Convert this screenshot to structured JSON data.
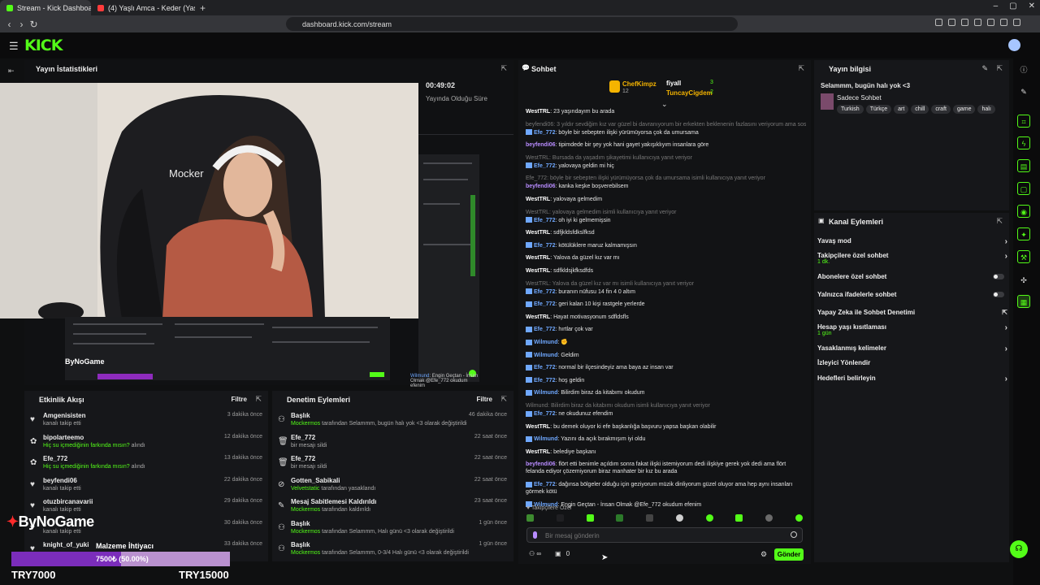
{
  "browser": {
    "tabs": [
      {
        "label": "Stream - Kick Dashboard",
        "fav_color": "#53fc18"
      },
      {
        "label": "(4) Yaşlı Amca - Keder (Yaşlı Amca) -",
        "fav_color": "#ff3b3b"
      }
    ],
    "url": "dashboard.kick.com/stream"
  },
  "brand": {
    "logo": "KICK",
    "accent": "#53fc18"
  },
  "stats": {
    "title": "Yayın İstatistikleri",
    "duration": "00:49:02",
    "duration_label": "Yayında Olduğu Süre"
  },
  "cam": {
    "chair_text": "Mocker"
  },
  "goal": {
    "title": "Malzeme İhtiyacı",
    "progress_text": "7500₺ (50.00%)",
    "progress": 0.5,
    "left": "TRY7000",
    "right": "TRY15000",
    "watermark": "ByNoGame",
    "small_watermark": "ByNoGame"
  },
  "feed": {
    "title": "Etkinlik Akışı",
    "filter": "Filtre",
    "items": [
      {
        "name": "Amgenisisten",
        "sub": "kanalı takip etti",
        "time": "3 dakika önce",
        "icon": "heart-icon"
      },
      {
        "name": "bipolarteemo",
        "sub_hl": "Hiç su içmediğinin farkında mısın?",
        "sub": "alındı",
        "time": "12 dakika önce",
        "icon": "gift-icon"
      },
      {
        "name": "Efe_772",
        "sub_hl": "Hiç su içmediğinin farkında mısın?",
        "sub": "alındı",
        "time": "13 dakika önce",
        "icon": "gift-icon"
      },
      {
        "name": "beyfendi06",
        "sub": "kanalı takip etti",
        "time": "22 dakika önce",
        "icon": "heart-icon"
      },
      {
        "name": "otuzbircanavarii",
        "sub": "kanalı takip etti",
        "time": "29 dakika önce",
        "icon": "heart-icon"
      },
      {
        "name": "",
        "sub": "kanalı takip etti",
        "time": "30 dakika önce",
        "icon": "heart-icon"
      },
      {
        "name": "knight_of_yuki",
        "sub": "",
        "time": "33 dakika önce",
        "icon": "heart-icon"
      }
    ]
  },
  "mod": {
    "title": "Denetim Eylemleri",
    "filter": "Filtre",
    "items": [
      {
        "name": "Başlık",
        "actor": "Mockermos",
        "sub": "tarafından Selammm, bugün halı yok <3 olarak değiştirildi",
        "time": "46 dakika önce",
        "icon": "people-icon"
      },
      {
        "name": "Efe_772",
        "actor": "",
        "sub": "bir mesajı sildi",
        "time": "22 saat önce",
        "icon": "trash-icon"
      },
      {
        "name": "Efe_772",
        "actor": "",
        "sub": "bir mesajı sildi",
        "time": "22 saat önce",
        "icon": "trash-icon"
      },
      {
        "name": "Gotten_Sabikali",
        "actor": "Velvetstatic",
        "sub": "tarafından yasaklandı",
        "time": "22 saat önce",
        "icon": "ban-icon"
      },
      {
        "name": "Mesaj Sabitlemesi Kaldırıldı",
        "actor": "Mockermos",
        "sub": "tarafından kaldırıldı",
        "time": "23 saat önce",
        "icon": "pin-icon"
      },
      {
        "name": "Başlık",
        "actor": "Mockermos",
        "sub": "tarafından Selammm, Halı günü <3 olarak değiştirildi",
        "time": "1 gün önce",
        "icon": "people-icon"
      },
      {
        "name": "Başlık",
        "actor": "Mockermos",
        "sub": "tarafından Selammm, 0-3/4 Halı günü <3 olarak değiştirildi",
        "time": "1 gün önce",
        "icon": "people-icon"
      }
    ]
  },
  "chat": {
    "title": "Sohbet",
    "leaders": [
      {
        "name": "ChefKimpz",
        "count": "12"
      },
      {
        "name": "fiyall",
        "count": "3"
      },
      {
        "name": "TuncayCigdem",
        "count": "2"
      }
    ],
    "messages": [
      {
        "user": "WestTRL",
        "cls": "cw",
        "text": "23 yaşındayım bu arada",
        "reply": ""
      },
      {
        "user": "Efe_772",
        "cls": "ce",
        "text": "böyle bir sebepten ilişki yürümüyorsa çok da umursama",
        "reply": "beyfendi06: 3 yıldır sevdiğim kız var güzel bi davranıyorum bir erkekten beklenenin fazlasını veriyorum ama sosyal..."
      },
      {
        "user": "beyfendi06",
        "cls": "cb",
        "text": "tipimdede bir şey yok hani gayet yakışıklıyım insanlara göre",
        "reply": ""
      },
      {
        "user": "Efe_772",
        "cls": "ce",
        "text": "yalovaya geldin mi hiç",
        "reply": "WestTRL: Bursada da yaşadım şikayetimi kullanıcıya yanıt veriyor"
      },
      {
        "user": "beyfendi06",
        "cls": "cb",
        "text": "kanka keşke boşverebilsem",
        "reply": "Efe_772: böyle bir sebepten ilişki yürümüyorsa çok da umursama isimli kullanıcıya yanıt veriyor"
      },
      {
        "user": "WestTRL",
        "cls": "cw",
        "text": "yalovaya gelmedim",
        "reply": ""
      },
      {
        "user": "Efe_772",
        "cls": "ce",
        "text": "oh iyi ki gelmemişsin",
        "reply": "WestTRL: yalovaya gelmedim isimli kullanıcıya yanıt veriyor"
      },
      {
        "user": "WestTRL",
        "cls": "cw",
        "text": "sdfjkldsfdkslfksd",
        "reply": ""
      },
      {
        "user": "Efe_772",
        "cls": "ce",
        "text": "kötülüklere maruz kalmamışsın",
        "reply": ""
      },
      {
        "user": "WestTRL",
        "cls": "cw",
        "text": "Yalova da güzel kız var mı",
        "reply": ""
      },
      {
        "user": "WestTRL",
        "cls": "cw",
        "text": "sdfkldsjkfksdfds",
        "reply": ""
      },
      {
        "user": "Efe_772",
        "cls": "ce",
        "text": "buranın nüfusu 14 fin 4 0 altım",
        "reply": "WestTRL: Yalova da güzel kız var mı isimli kullanıcıya yanıt veriyor"
      },
      {
        "user": "Efe_772",
        "cls": "ce",
        "text": "geri kalan 10 kişi rastgele yerlerde",
        "reply": ""
      },
      {
        "user": "WestTRL",
        "cls": "cw",
        "text": "Hayat motivasyonum sdfldsfls",
        "reply": ""
      },
      {
        "user": "Efe_772",
        "cls": "ce",
        "text": "hırtlar çok var",
        "reply": ""
      },
      {
        "user": "Wilmund",
        "cls": "cwi",
        "text": "✊",
        "reply": ""
      },
      {
        "user": "Wilmund",
        "cls": "cwi",
        "text": "Geldim",
        "reply": ""
      },
      {
        "user": "Efe_772",
        "cls": "ce",
        "text": "normal bir ilçesindeyiz ama baya az insan var",
        "reply": ""
      },
      {
        "user": "Efe_772",
        "cls": "ce",
        "text": "hoş geldin",
        "reply": ""
      },
      {
        "user": "Wilmund",
        "cls": "cwi",
        "text": "Bilirdim biraz da kitabımı okudum",
        "reply": ""
      },
      {
        "user": "Efe_772",
        "cls": "ce",
        "text": "ne okudunuz efendim",
        "reply": "Wilmund: Bilirdim biraz da kitabımı okudum isimli kullanıcıya yanıt veriyor"
      },
      {
        "user": "WestTRL",
        "cls": "cw",
        "text": "bu demek oluyor ki efe başkanlığa başvuru yapsa başkan olabilir",
        "reply": ""
      },
      {
        "user": "Wilmund",
        "cls": "cwi",
        "text": "Yazını da açık bırakmışım iyi oldu",
        "reply": ""
      },
      {
        "user": "WestTRL",
        "cls": "cw",
        "text": "belediye başkanı",
        "reply": ""
      },
      {
        "user": "beyfendi06",
        "cls": "cb",
        "text": "flört etti benimle açıldım sonra fakat ilişki istemiyorum dedi ilişkiye gerek yok dedi ama flört felanda ediyor çözemiyorum biraz manhater bir kız bu arada",
        "reply": ""
      },
      {
        "user": "Efe_772",
        "cls": "ce",
        "text": "dağınsa bölgeler olduğu için geziyorum müzik dinliyorum güzel oluyor ama hep aynı insanları görmek kötü",
        "reply": ""
      },
      {
        "user": "Wilmund",
        "cls": "cwi",
        "text": "Engin Geçtan - İnsan Olmak @Efe_772 okudum efenim",
        "reply": ""
      }
    ],
    "followers_only": "Takipçilere Özel",
    "input_placeholder": "Bir mesaj gönderin",
    "send_label": "Gönder",
    "points": "0",
    "overlay_msg_user": "Wilmund",
    "overlay_msg_text": "Engin Geçtan - İnsan Olmak @Efe_772 okudum efenim"
  },
  "info": {
    "title": "Yayın bilgisi",
    "stream_title": "Selammm, bugün halı yok <3",
    "category": "Sadece Sohbet",
    "tags": [
      "Turkish",
      "Türkçe",
      "art",
      "chill",
      "craft",
      "game",
      "halı"
    ]
  },
  "actions": {
    "title": "Kanal Eylemleri",
    "items": [
      {
        "label": "Yavaş mod",
        "sub": "",
        "ctl": "chev"
      },
      {
        "label": "Takipçilere özel sohbet",
        "sub": "1 dk.",
        "ctl": "chev"
      },
      {
        "label": "Abonelere özel sohbet",
        "sub": "",
        "ctl": "toggle"
      },
      {
        "label": "Yalnızca ifadelerle sohbet",
        "sub": "",
        "ctl": "toggle"
      },
      {
        "label": "Yapay Zeka ile Sohbet Denetimi",
        "sub": "",
        "ctl": "ext"
      },
      {
        "label": "Hesap yaşı kısıtlaması",
        "sub": "1 gün",
        "ctl": "chev"
      },
      {
        "label": "Yasaklanmış kelimeler",
        "sub": "",
        "ctl": "chev"
      },
      {
        "label": "İzleyici Yönlendir",
        "sub": "",
        "ctl": ""
      },
      {
        "label": "Hedefleri belirleyin",
        "sub": "",
        "ctl": "chev"
      }
    ]
  }
}
